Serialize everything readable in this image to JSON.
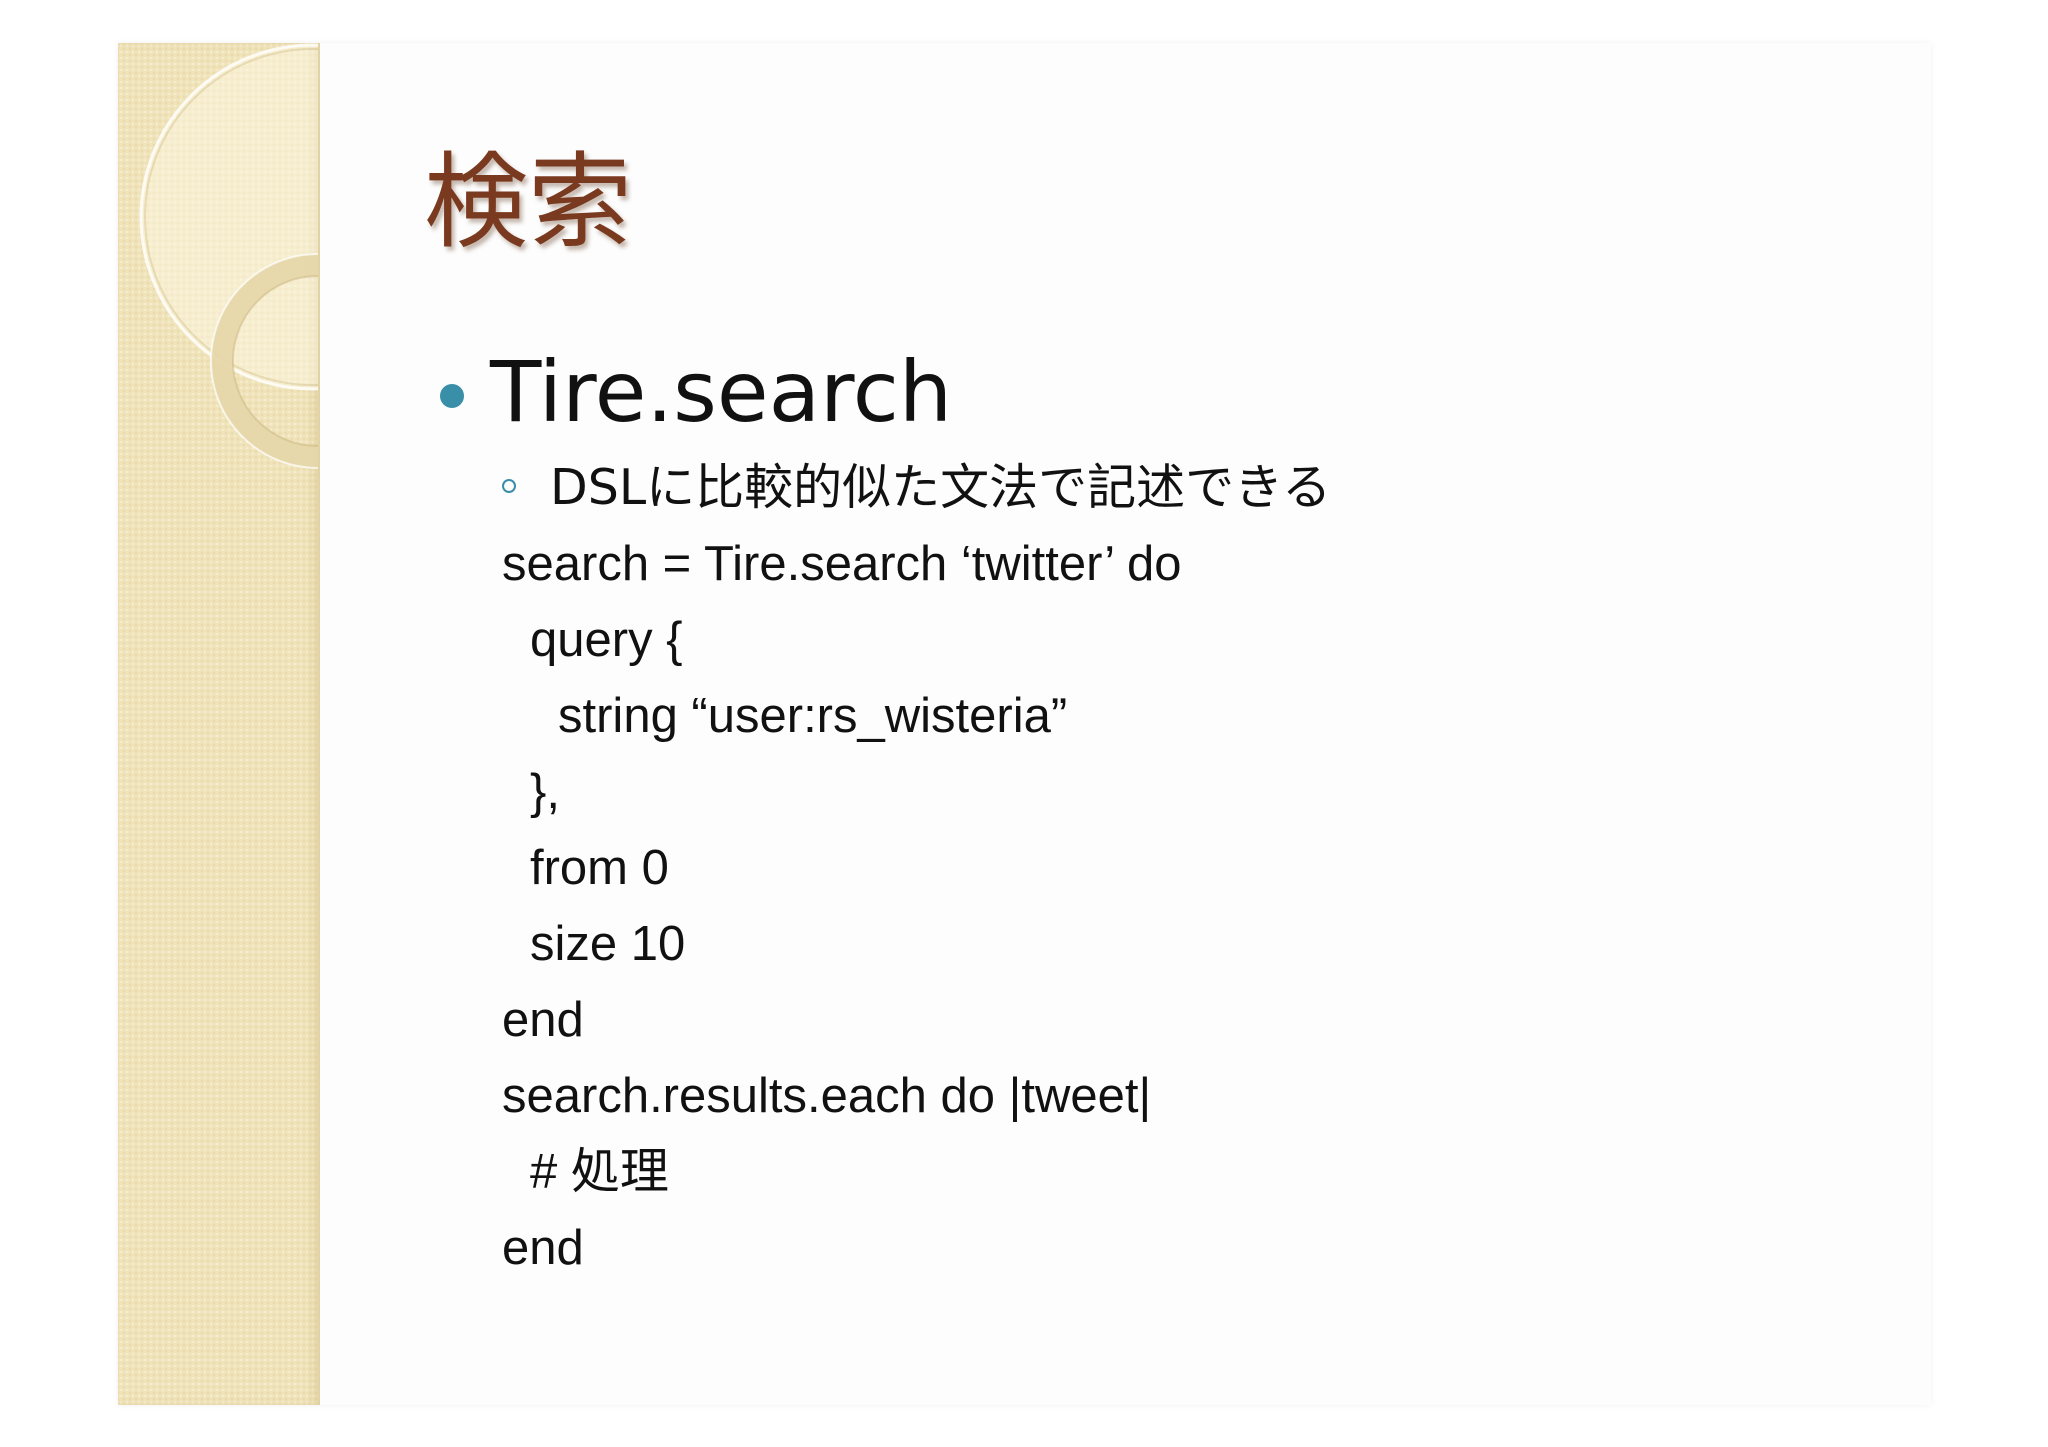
{
  "slide": {
    "title": "検索",
    "bullet": "Tire.search",
    "sub_bullet": "DSLに比較的似た文法で記述できる",
    "code_lines": [
      "search = Tire.search ‘twitter’ do",
      "query {",
      "string “user:rs_wisteria”",
      "},",
      "from 0",
      "size 10",
      "end",
      "search.results.each do |tweet|",
      "# 処理",
      "end"
    ]
  },
  "colors": {
    "title": "#7a3a1f",
    "bullet_accent": "#3a8fa8",
    "side_band": "#f0e3b9",
    "text": "#111111"
  }
}
